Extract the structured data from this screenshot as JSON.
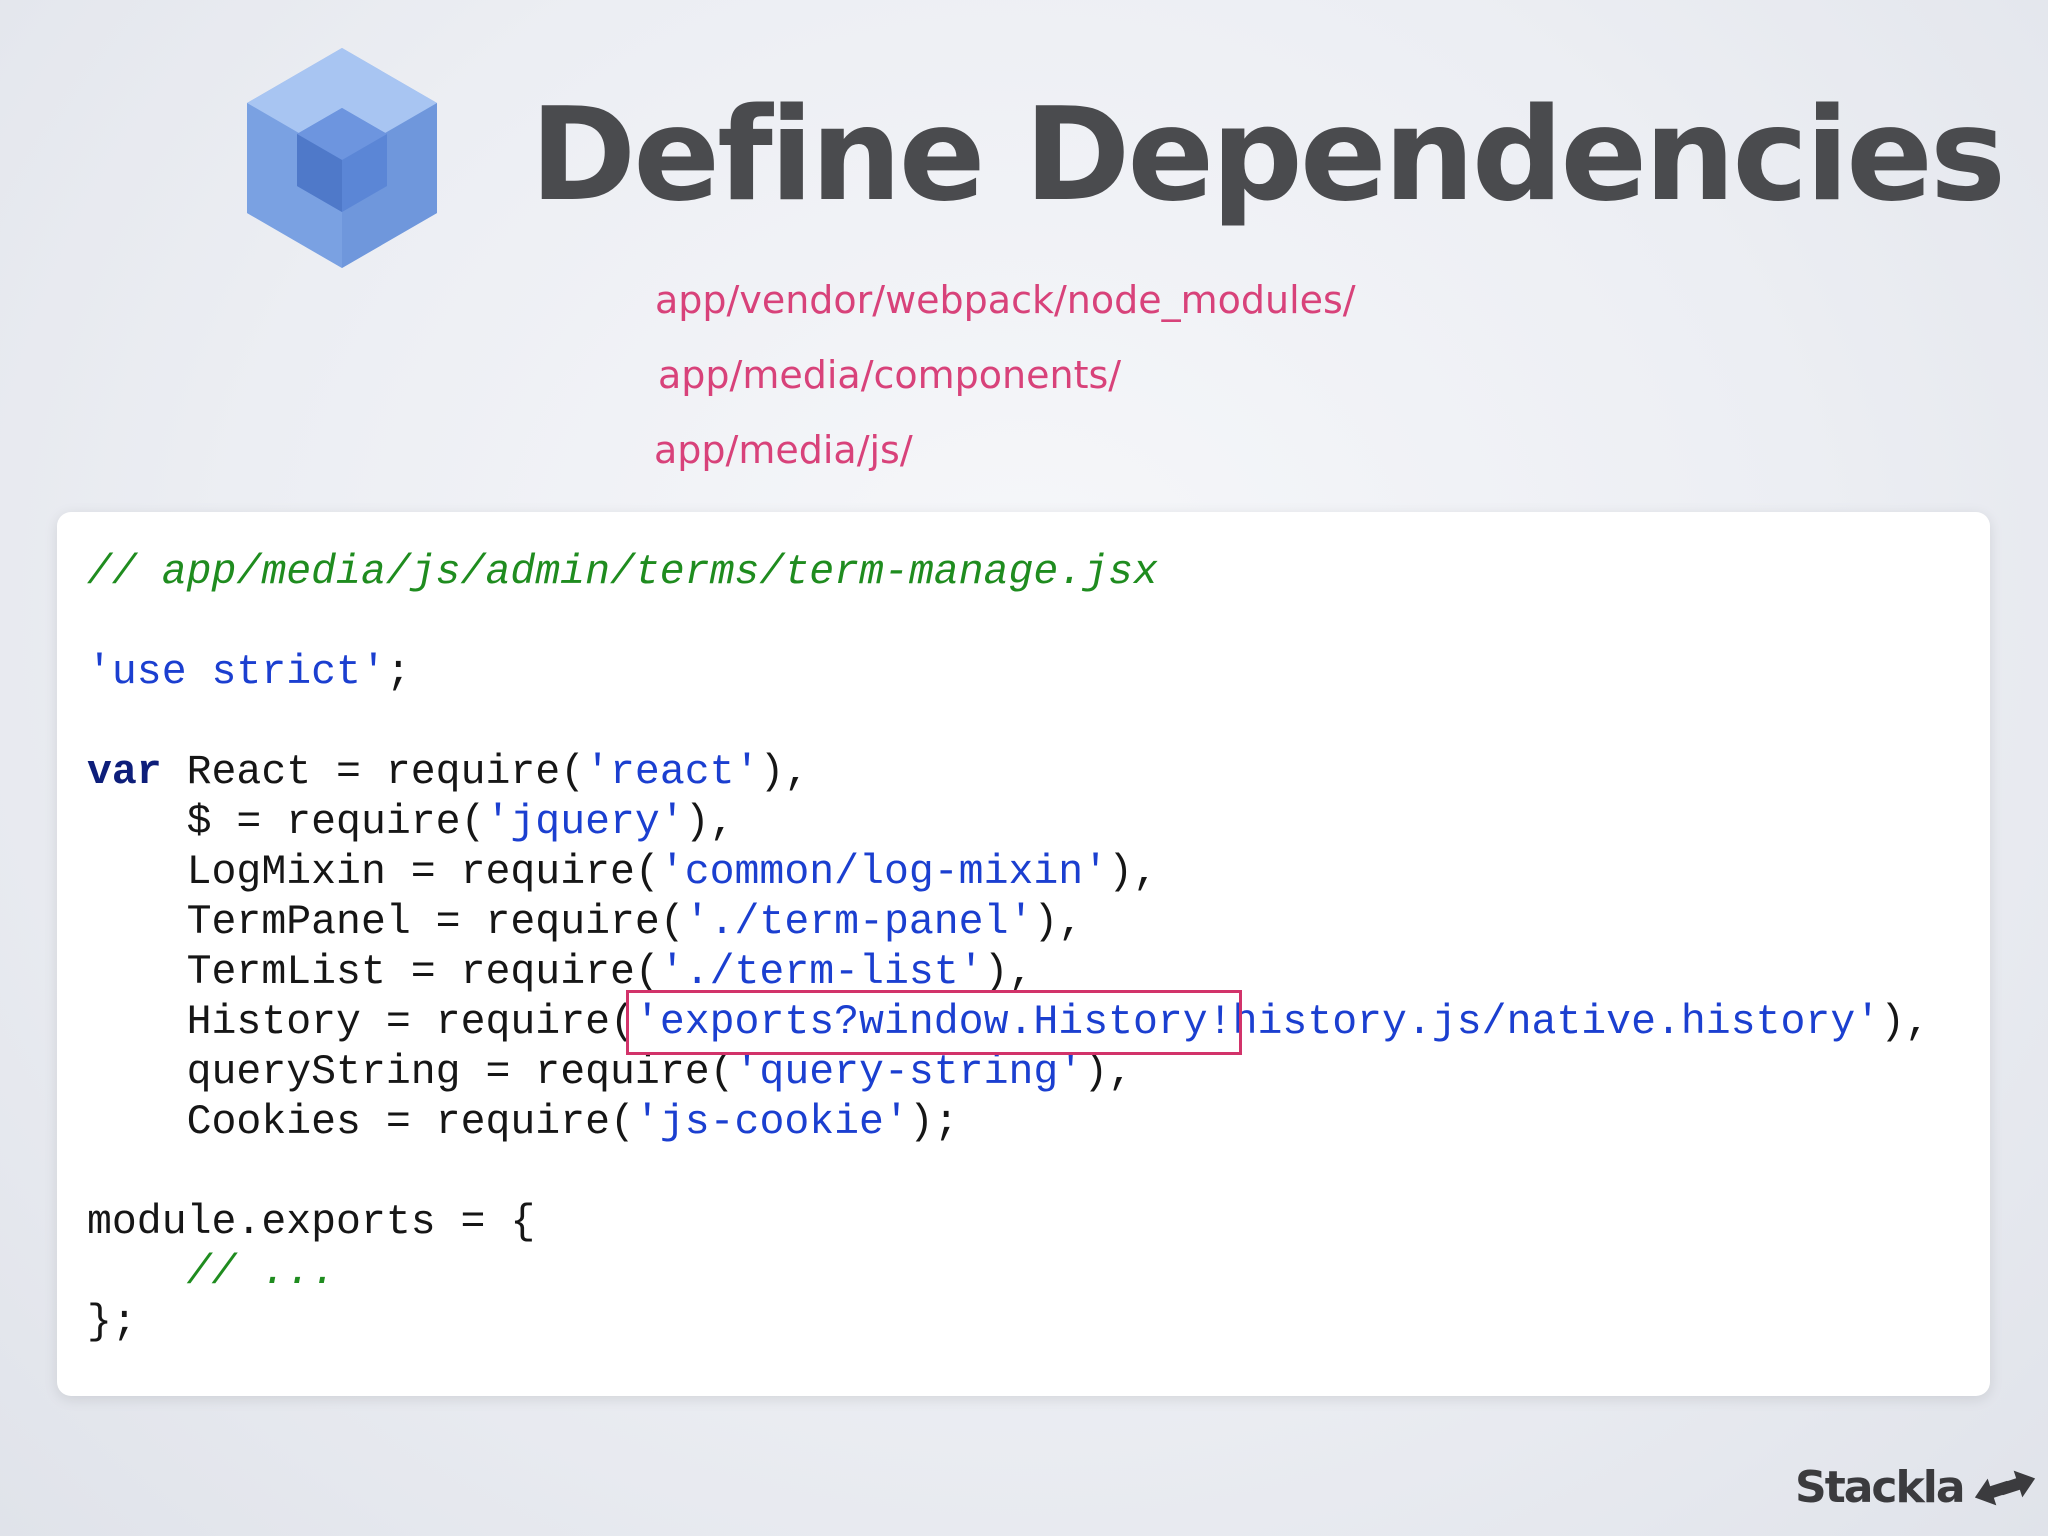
{
  "slide": {
    "title": "Define Dependencies",
    "paths": [
      "app/vendor/webpack/node_modules/",
      "app/media/components/",
      "app/media/js/"
    ]
  },
  "code": {
    "file_comment": "// app/media/js/admin/terms/term-manage.jsx",
    "use_strict": "'use strict'",
    "semicolon": ";",
    "var_keyword": "var",
    "requires": [
      {
        "indent": "",
        "name": "React",
        "module": "'react'",
        "end": "),"
      },
      {
        "indent": "    ",
        "name": "$",
        "module": "'jquery'",
        "end": "),"
      },
      {
        "indent": "    ",
        "name": "LogMixin",
        "module": "'common/log-mixin'",
        "end": "),"
      },
      {
        "indent": "    ",
        "name": "TermPanel",
        "module": "'./term-panel'",
        "end": "),"
      },
      {
        "indent": "    ",
        "name": "TermList",
        "module": "'./term-list'",
        "end": "),"
      },
      {
        "indent": "    ",
        "name": "History",
        "module_highlight": "'exports?window.History!",
        "module_rest": "history.js/native.history'",
        "end": "),"
      },
      {
        "indent": "    ",
        "name": "queryString",
        "module": "'query-string'",
        "end": "),"
      },
      {
        "indent": "    ",
        "name": "Cookies",
        "module": "'js-cookie'",
        "end": ");"
      }
    ],
    "assign_sep": " = ",
    "require_call": "require(",
    "exports_open": "module.exports = {",
    "exports_comment": "    // ...",
    "exports_close": "};"
  },
  "brand": {
    "name": "Stackla",
    "icon": "stackla-arrows-icon"
  },
  "colors": {
    "title": "#4a4b4e",
    "path": "#d8427a",
    "comment": "#1f8c1f",
    "string": "#1b3fd0",
    "keyword": "#0d1e7a",
    "highlight_box": "#d2336a",
    "logo_cube": "#5b86d6"
  }
}
